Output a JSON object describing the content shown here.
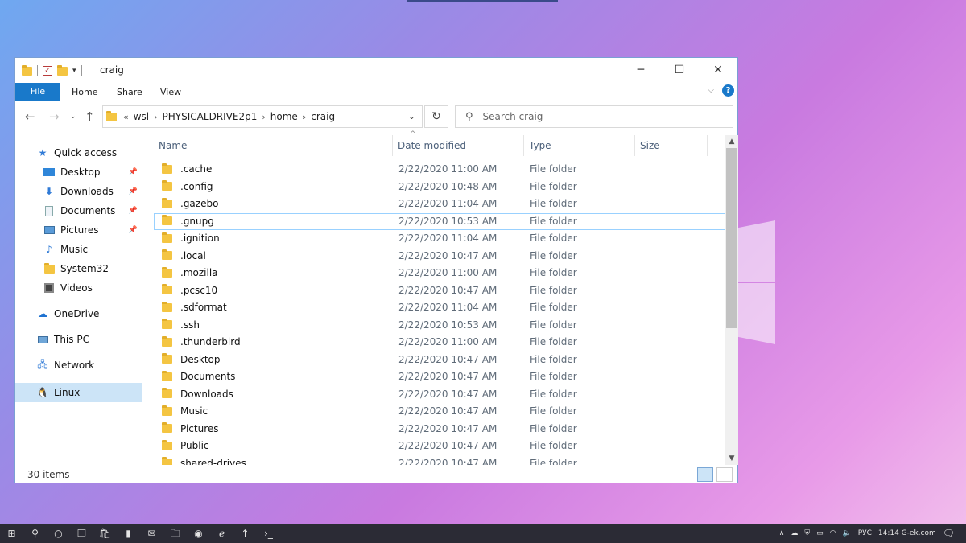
{
  "window": {
    "title": "craig"
  },
  "ribbon": {
    "tabs": [
      "File",
      "Home",
      "Share",
      "View"
    ]
  },
  "address": {
    "prefix": "«",
    "crumbs": [
      "wsl",
      "PHYSICALDRIVE2p1",
      "home",
      "craig"
    ]
  },
  "search": {
    "placeholder": "Search craig"
  },
  "sidebar": {
    "quick_access": "Quick access",
    "items": [
      "Desktop",
      "Downloads",
      "Documents",
      "Pictures",
      "Music",
      "System32",
      "Videos"
    ],
    "onedrive": "OneDrive",
    "this_pc": "This PC",
    "network": "Network",
    "linux": "Linux"
  },
  "columns": {
    "name": "Name",
    "date": "Date modified",
    "type": "Type",
    "size": "Size"
  },
  "files": [
    {
      "name": ".cache",
      "date": "2/22/2020 11:00 AM",
      "type": "File folder"
    },
    {
      "name": ".config",
      "date": "2/22/2020 10:48 AM",
      "type": "File folder"
    },
    {
      "name": ".gazebo",
      "date": "2/22/2020 11:04 AM",
      "type": "File folder"
    },
    {
      "name": ".gnupg",
      "date": "2/22/2020 10:53 AM",
      "type": "File folder"
    },
    {
      "name": ".ignition",
      "date": "2/22/2020 11:04 AM",
      "type": "File folder"
    },
    {
      "name": ".local",
      "date": "2/22/2020 10:47 AM",
      "type": "File folder"
    },
    {
      "name": ".mozilla",
      "date": "2/22/2020 11:00 AM",
      "type": "File folder"
    },
    {
      "name": ".pcsc10",
      "date": "2/22/2020 10:47 AM",
      "type": "File folder"
    },
    {
      "name": ".sdformat",
      "date": "2/22/2020 11:04 AM",
      "type": "File folder"
    },
    {
      "name": ".ssh",
      "date": "2/22/2020 10:53 AM",
      "type": "File folder"
    },
    {
      "name": ".thunderbird",
      "date": "2/22/2020 11:00 AM",
      "type": "File folder"
    },
    {
      "name": "Desktop",
      "date": "2/22/2020 10:47 AM",
      "type": "File folder"
    },
    {
      "name": "Documents",
      "date": "2/22/2020 10:47 AM",
      "type": "File folder"
    },
    {
      "name": "Downloads",
      "date": "2/22/2020 10:47 AM",
      "type": "File folder"
    },
    {
      "name": "Music",
      "date": "2/22/2020 10:47 AM",
      "type": "File folder"
    },
    {
      "name": "Pictures",
      "date": "2/22/2020 10:47 AM",
      "type": "File folder"
    },
    {
      "name": "Public",
      "date": "2/22/2020 10:47 AM",
      "type": "File folder"
    },
    {
      "name": "shared-drives",
      "date": "2/22/2020 10:47 AM",
      "type": "File folder"
    }
  ],
  "status": {
    "count": "30 items"
  },
  "tray": {
    "lang": "РУС",
    "clock": "14:14 G-ek.com"
  }
}
